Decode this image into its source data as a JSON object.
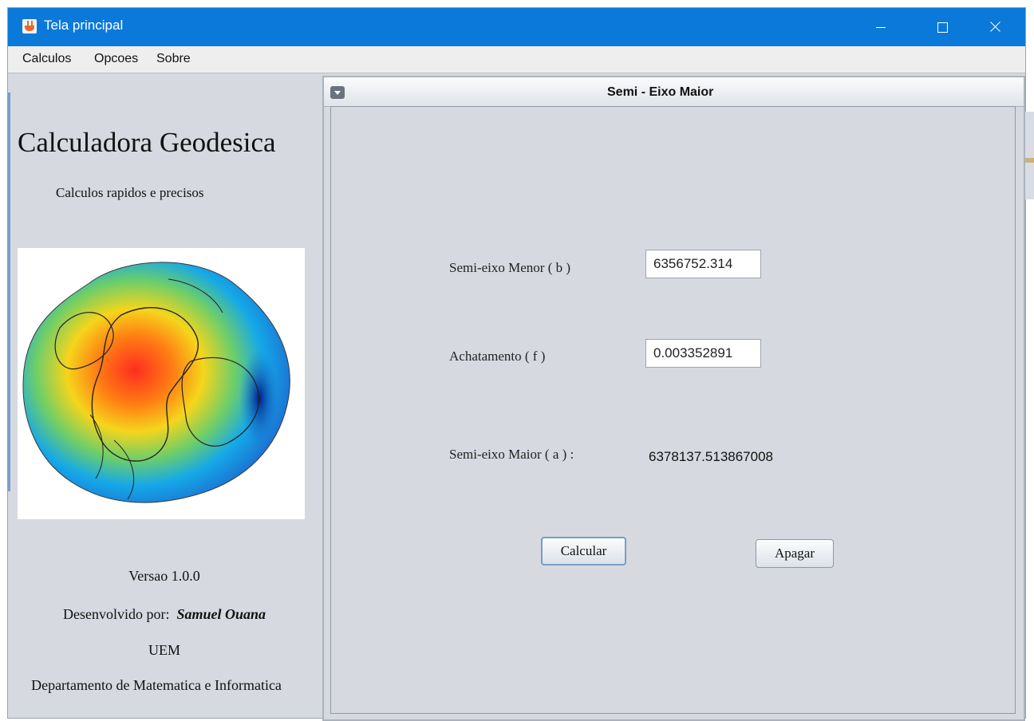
{
  "window": {
    "title": "Tela principal",
    "colors": {
      "titlebar": "#0A79D9",
      "background": "#D6D9DF"
    }
  },
  "menu": [
    "Calculos",
    "Opcoes",
    "Sobre"
  ],
  "left_panel": {
    "title": "Calculadora Geodesica",
    "subtitle": "Calculos rapidos e precisos",
    "version": "Versao 1.0.0",
    "developed_by": "Desenvolvido por:",
    "author": "Samuel Ouana",
    "institution": "UEM",
    "department": "Departamento de Matematica e Informatica"
  },
  "internal_frame": {
    "title": "Semi - Eixo Maior",
    "minor_axis_label": "Semi-eixo Menor ( b )",
    "minor_axis_value": "6356752.314",
    "flattening_label": "Achatamento ( f )",
    "flattening_value": "0.003352891",
    "major_axis_label": "Semi-eixo Maior ( a ) :",
    "major_axis_value": "6378137.513867008",
    "calculate_button": "Calcular",
    "clear_button": "Apagar"
  }
}
